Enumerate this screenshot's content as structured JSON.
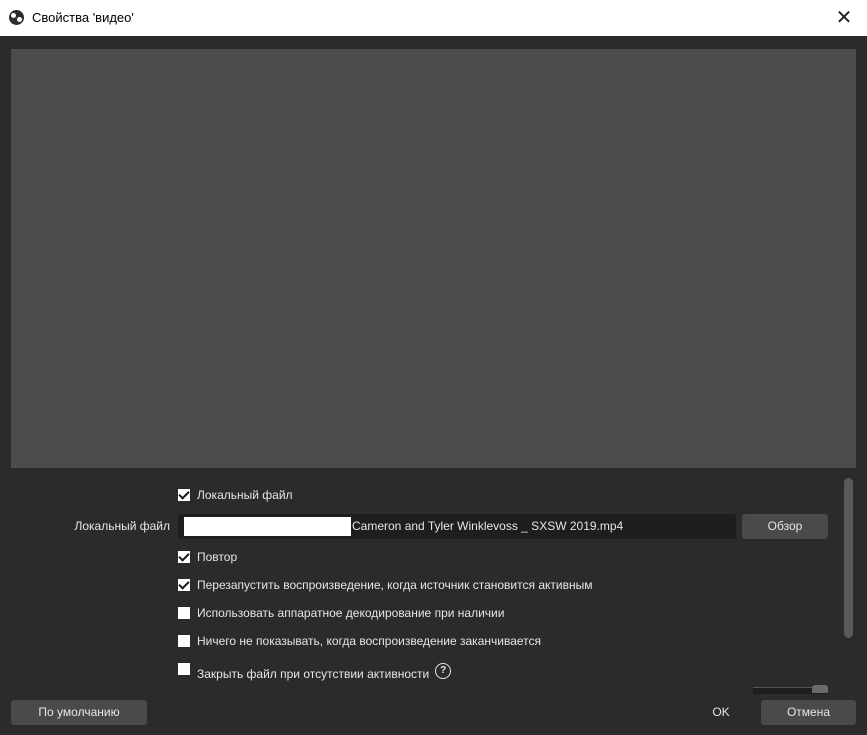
{
  "window": {
    "title": "Свойства 'видео'",
    "close_symbol": "✕",
    "icon": "obs-logo-icon"
  },
  "properties": {
    "local_file_checkbox": {
      "label": "Локальный файл",
      "checked": true
    },
    "local_file_field": {
      "label": "Локальный файл",
      "value": "Cameron and Tyler Winklevoss _ SXSW 2019.mp4",
      "browse_label": "Обзор"
    },
    "loop": {
      "label": "Повтор",
      "checked": true
    },
    "restart": {
      "label": "Перезапустить воспроизведение, когда источник становится активным",
      "checked": true
    },
    "hw_decode": {
      "label": "Использовать аппаратное декодирование при наличии",
      "checked": false
    },
    "show_nothing": {
      "label": "Ничего не показывать, когда воспроизведение заканчивается",
      "checked": false
    },
    "close_file": {
      "label": "Закрыть файл при отсутствии активности",
      "checked": false,
      "help_symbol": "?"
    }
  },
  "footer": {
    "defaults_label": "По умолчанию",
    "ok_label": "OK",
    "cancel_label": "Отмена"
  },
  "colors": {
    "background": "#2b2b2b",
    "preview": "#4c4c4c",
    "input": "#1e1e1e",
    "button": "#4a4a4a"
  }
}
